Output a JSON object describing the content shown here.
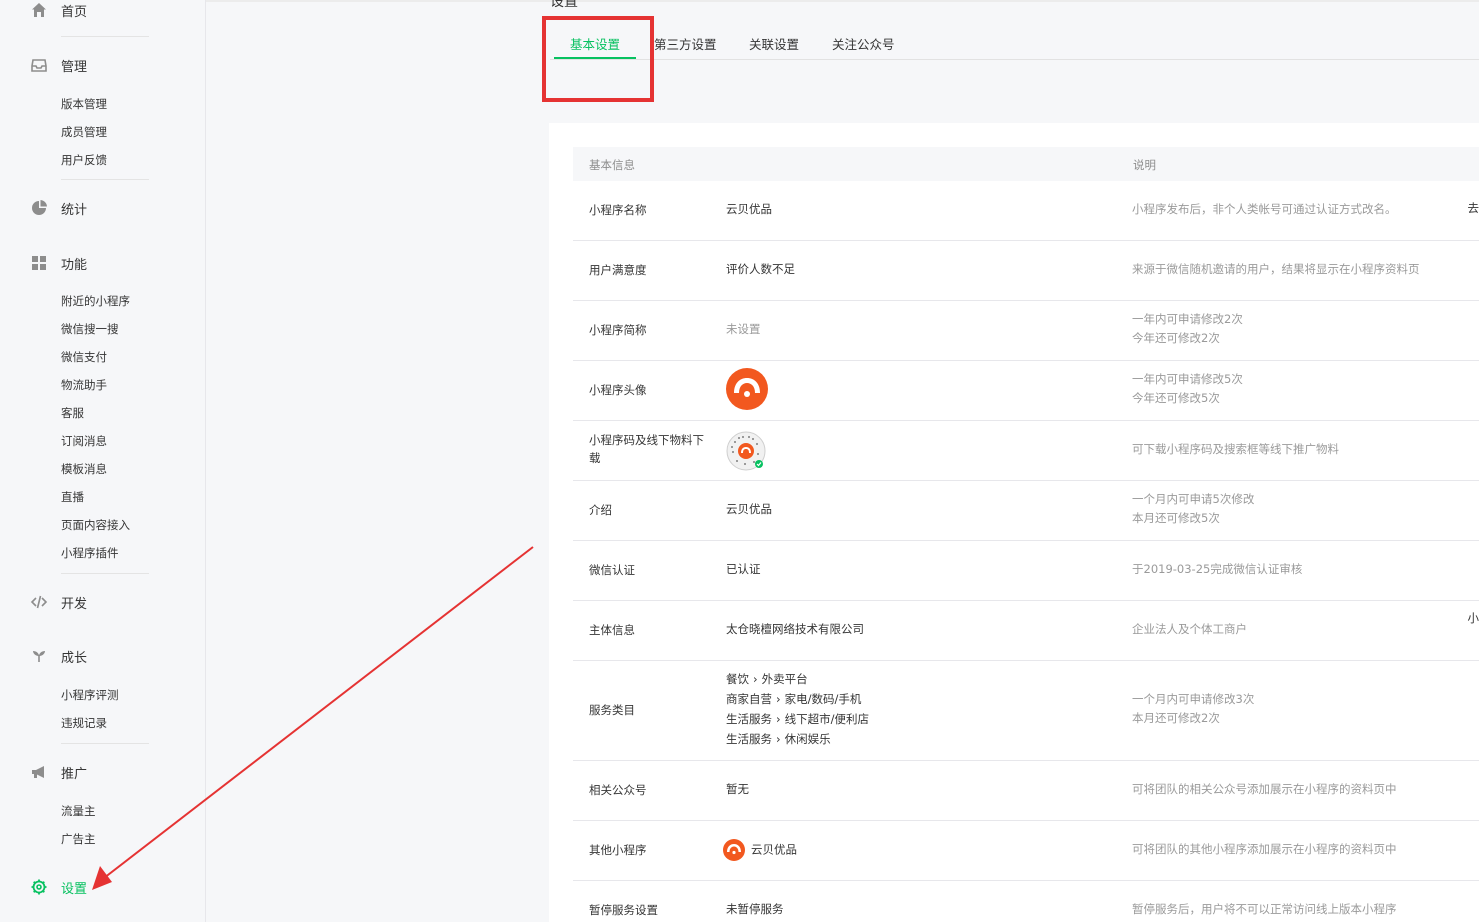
{
  "sidebar": {
    "home": "首页",
    "manage": {
      "label": "管理",
      "items": [
        "版本管理",
        "成员管理",
        "用户反馈"
      ]
    },
    "stats": "统计",
    "features": {
      "label": "功能",
      "items": [
        "附近的小程序",
        "微信搜一搜",
        "微信支付",
        "物流助手",
        "客服",
        "订阅消息",
        "模板消息",
        "直播",
        "页面内容接入",
        "小程序插件"
      ]
    },
    "develop": "开发",
    "growth": {
      "label": "成长",
      "items": [
        "小程序评测",
        "违规记录"
      ]
    },
    "promote": {
      "label": "推广",
      "items": [
        "流量主",
        "广告主"
      ]
    },
    "settings": "设置"
  },
  "header": {
    "title_fragment": "设置",
    "tabs": [
      "基本设置",
      "第三方设置",
      "关联设置",
      "关注公众号"
    ],
    "active_tab": 0
  },
  "table": {
    "col_basic": "基本信息",
    "col_desc": "说明",
    "rows": [
      {
        "label": "小程序名称",
        "value": "云贝优品",
        "desc": [
          "小程序发布后，非个人类帐号可通过认证方式改名。"
        ],
        "edge": "去"
      },
      {
        "label": "用户满意度",
        "value": "评价人数不足",
        "desc": [
          "来源于微信随机邀请的用户，结果将显示在小程序资料页"
        ]
      },
      {
        "label": "小程序简称",
        "value": "未设置",
        "desc": [
          "一年内可申请修改2次",
          "今年还可修改2次"
        ]
      },
      {
        "label": "小程序头像",
        "value": "",
        "desc": [
          "一年内可申请修改5次",
          "今年还可修改5次"
        ]
      },
      {
        "label": "小程序码及线下物料下载",
        "value": "",
        "desc": [
          "可下载小程序码及搜索框等线下推广物料"
        ]
      },
      {
        "label": "介绍",
        "value": "云贝优品",
        "desc": [
          "一个月内可申请5次修改",
          "本月还可修改5次"
        ]
      },
      {
        "label": "微信认证",
        "value": "已认证",
        "desc": [
          "于2019-03-25完成微信认证审核"
        ]
      },
      {
        "label": "主体信息",
        "value": "太仓晓檀网络技术有限公司",
        "desc": [
          "企业法人及个体工商户"
        ],
        "edge": "小"
      },
      {
        "label": "服务类目",
        "categories": [
          [
            "餐饮",
            "外卖平台"
          ],
          [
            "商家自营",
            "家电/数码/手机"
          ],
          [
            "生活服务",
            "线下超市/便利店"
          ],
          [
            "生活服务",
            "休闲娱乐"
          ]
        ],
        "desc": [
          "一个月内可申请修改3次",
          "本月还可修改2次"
        ]
      },
      {
        "label": "相关公众号",
        "value": "暂无",
        "desc": [
          "可将团队的相关公众号添加展示在小程序的资料页中"
        ]
      },
      {
        "label": "其他小程序",
        "value": "云贝优品",
        "desc": [
          "可将团队的其他小程序添加展示在小程序的资料页中"
        ]
      },
      {
        "label": "暂停服务设置",
        "value": "未暂停服务",
        "desc": [
          "暂停服务后，用户将不可以正常访问线上版本小程序"
        ]
      }
    ]
  },
  "colors": {
    "accent": "#07c160",
    "annotation_red": "#e53333",
    "logo_orange": "#f2581f"
  }
}
